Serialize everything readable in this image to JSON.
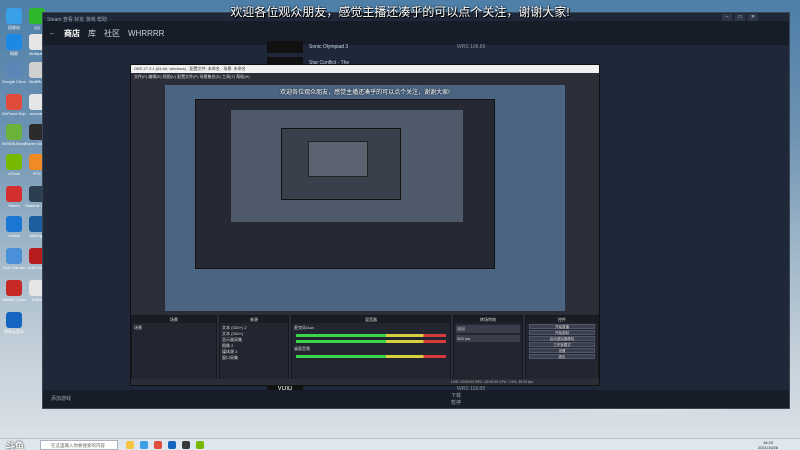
{
  "caption": "欢迎各位观众朋友，感觉主播还凑乎的可以点个关注，谢谢大家!",
  "steam": {
    "nav_back": "←",
    "tabs": [
      "商店",
      "库",
      "社区",
      "WHRRRR"
    ],
    "games": [
      {
        "name": "Sonic Olympiad 3",
        "meta": "WRS 106.89"
      },
      {
        "name": "Star Conflict - The",
        "meta": ""
      }
    ],
    "bottom_left": "添加游戏",
    "bottom_mid": "下载",
    "bottom_mid2": "暂停",
    "bottom_game": "VOID",
    "bottom_game_meta": "WRS 118.89"
  },
  "obs": {
    "title": "OBS 27.0.1 (64-bit, windows) - 配置文件: 未命名 - 场景: 未命名",
    "menu": "文件(F)  编辑(E)  视图(V)  配置文件(P)  场景集合(S)  工具(T)  帮助(H)",
    "inner_caption": "欢迎各位观众朋友，感觉主播还凑乎的可以点个关注，谢谢大家!",
    "docks": {
      "scenes": "场景",
      "sources": "来源",
      "mixer": "混音器",
      "transitions": "转场特效",
      "controls": "控件"
    },
    "scene_item": "场景",
    "source_items": [
      "文本 (GDI+) 2",
      "文本 (GDI+)",
      "显示器采集",
      "图像 2",
      "媒体源 2",
      "窗口采集"
    ],
    "mixer_items": [
      "麦克风/Aux",
      "桌面音频"
    ],
    "transition_value": "淡出",
    "transition_duration": "300 ms",
    "control_buttons": [
      "开始直播",
      "开始录制",
      "启动虚拟摄像机",
      "工作室模式",
      "设置",
      "退出"
    ],
    "status": "LIVE: 00:00:00   REC: 00:00:00   CPU: 7.6%, 30.00 fps"
  },
  "taskbar": {
    "logo": "斗鱼",
    "search_placeholder": "在这里输入你要搜索的内容",
    "time": "16:29",
    "date": "2021/10/26"
  },
  "desktop_icons": [
    "回收站",
    "QQ",
    "网易",
    "Multiplex",
    "Google Chrome",
    "MultiRun",
    "GeForce Experience",
    "recorder",
    "NVIDIA Broadcast",
    "Ryzen Master",
    "uTools",
    "RTX",
    "Steam",
    "Shadow Tactics",
    "Adobe",
    "MyEdge",
    "Epic Games",
    "Guild Wars",
    "Ubisoft Connect",
    "Twitch",
    "网易云音乐"
  ]
}
